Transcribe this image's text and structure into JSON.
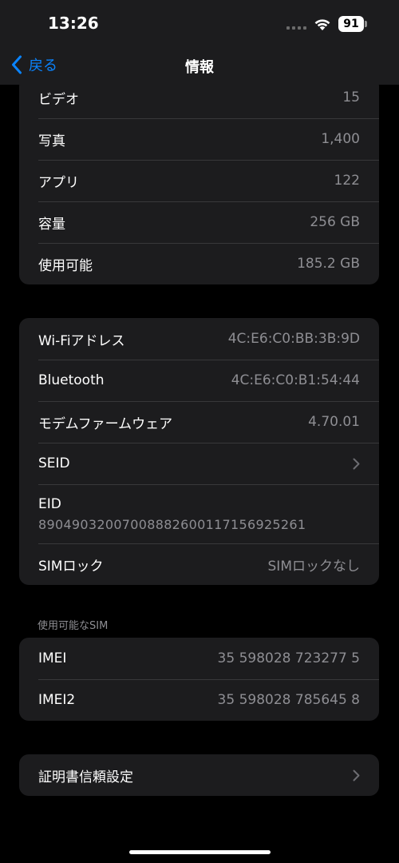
{
  "status_bar": {
    "time": "13:26",
    "battery": "91"
  },
  "nav": {
    "back_label": "戻る",
    "title": "情報"
  },
  "group1": [
    {
      "label": "ビデオ",
      "value": "15"
    },
    {
      "label": "写真",
      "value": "1,400"
    },
    {
      "label": "アプリ",
      "value": "122"
    },
    {
      "label": "容量",
      "value": "256 GB"
    },
    {
      "label": "使用可能",
      "value": "185.2 GB"
    }
  ],
  "group2": {
    "wifi": {
      "label": "Wi-Fiアドレス",
      "value": "4C:E6:C0:BB:3B:9D"
    },
    "bluetooth": {
      "label": "Bluetooth",
      "value": "4C:E6:C0:B1:54:44"
    },
    "modem": {
      "label": "モデムファームウェア",
      "value": "4.70.01"
    },
    "seid": {
      "label": "SEID"
    },
    "eid": {
      "label": "EID",
      "value": "89049032007008882600117156925261"
    },
    "simlock": {
      "label": "SIMロック",
      "value": "SIMロックなし"
    }
  },
  "sim_section": {
    "header": "使用可能なSIM",
    "imei": {
      "label": "IMEI",
      "value": "35 598028 723277 5"
    },
    "imei2": {
      "label": "IMEI2",
      "value": "35 598028 785645 8"
    }
  },
  "certificate": {
    "label": "証明書信頼設定"
  },
  "colors": {
    "accent": "#0a84ff",
    "background": "#000000",
    "cell": "#1c1c1e",
    "secondary_text": "#8e8e93"
  }
}
